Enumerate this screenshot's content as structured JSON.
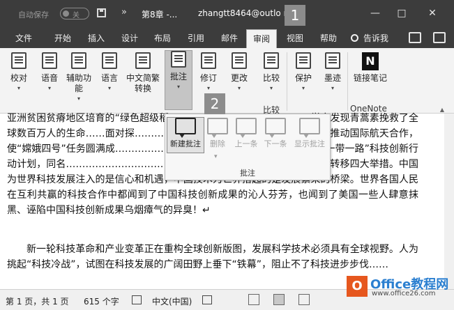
{
  "titlebar": {
    "autosave": "自动保存",
    "autosave_state": "关",
    "more": "»",
    "doc_title": "第8章 -...",
    "user": "zhangtt8464@outlo    m",
    "minimize": "—",
    "restore": "□",
    "close": "✕"
  },
  "badges": {
    "one": "1",
    "two": "2"
  },
  "tabs": [
    "文件",
    "开始",
    "插入",
    "设计",
    "布局",
    "引用",
    "邮件",
    "审阅",
    "视图",
    "帮助"
  ],
  "active_tab": "审阅",
  "tellme": "告诉我",
  "ribbon": {
    "proof": "校对",
    "language": "语音",
    "accessibility": "辅助功能",
    "lang2": "语言",
    "chinese_convert": "中文简繁转换",
    "comment": "批注",
    "track": "修订",
    "changes": "更改",
    "compare": "比较",
    "protect": "保护",
    "ink": "墨迹",
    "linked_notes": "链接笔记",
    "group_compare": "比较",
    "group_onenote": "OneNote",
    "onenote_letter": "N"
  },
  "dropdown": {
    "new_comment": "新建批注",
    "delete": "删除",
    "previous": "上一条",
    "next": "下一条",
    "show_comments": "显示批注",
    "group_label": "批注"
  },
  "document": {
    "p1": "亚洲贫困贫瘠地区培育的“绿色超级稻”……………………………………学家发现青蒿素挽救了全球数百万人的生命……面对探…………………………………………中国积极推动国际航天合作，使“嫦娥四号”任务圆满成……………………………………诺继续实施共建“一带一路”科技创新行动计划，同名……………………………………实验室、科技园区合作、技术转移四大举措。中国为世界科技发展注入的是信心和机遇，中国技术为世界搭起的是发展繁荣的桥梁。世界各国人民在互利共赢的科技合作中都闻到了中国科技创新成果的沁人芬芳，也闻到了美国一些人肆意抹黑、诬陷中国科技创新成果乌烟瘴气的异臭！↵",
    "p2": "新一轮科技革命和产业变革正在重构全球创新版图，发展科学技术必须具有全球视野。人为挑起“科技冷战”，试图在科技发展的广阔田野上垂下“铁幕”，阻止不了科技进步步伐……"
  },
  "status": {
    "page": "第 1 页，共 1 页",
    "words": "615 个字",
    "lang": "中文(中国)"
  },
  "watermark": {
    "logo": "O",
    "text": "Office教程网",
    "url": "www.office26.com"
  }
}
